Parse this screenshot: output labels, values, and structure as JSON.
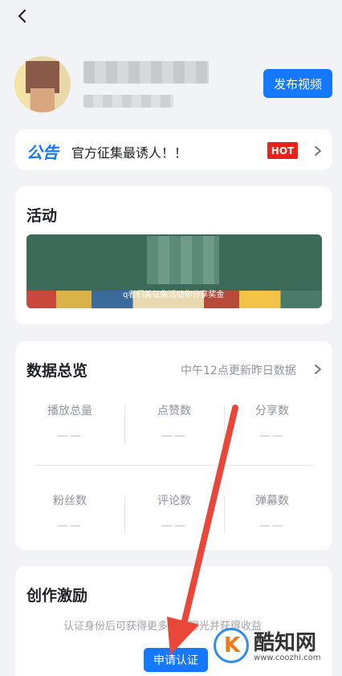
{
  "header": {
    "back_icon": "chevron-left-icon",
    "publish_label": "发布视频"
  },
  "notice": {
    "title": "公告",
    "text": "官方征集最诱人！！",
    "badge": "HOT"
  },
  "activity": {
    "title": "活动",
    "banner_text": "q者们美征集活动你分享奖金"
  },
  "stats": {
    "title": "数据总览",
    "note": "中午12点更新昨日数据",
    "items": [
      {
        "label": "播放总量",
        "value": "——"
      },
      {
        "label": "点赞数",
        "value": "——"
      },
      {
        "label": "分享数",
        "value": "——"
      },
      {
        "label": "粉丝数",
        "value": "——"
      },
      {
        "label": "评论数",
        "value": "——"
      },
      {
        "label": "弹幕数",
        "value": "——"
      }
    ]
  },
  "incentive": {
    "title": "创作激励",
    "description": "认证身份后可获得更多流量曝光并获得收益",
    "apply_label": "申请认证"
  },
  "watermark": {
    "name": "酷知网",
    "url": "www.coozhi.com",
    "logo_letter": "K"
  },
  "colors": {
    "accent": "#1677ff",
    "hot": "#e5231b",
    "annotation_arrow": "#e8473a"
  }
}
